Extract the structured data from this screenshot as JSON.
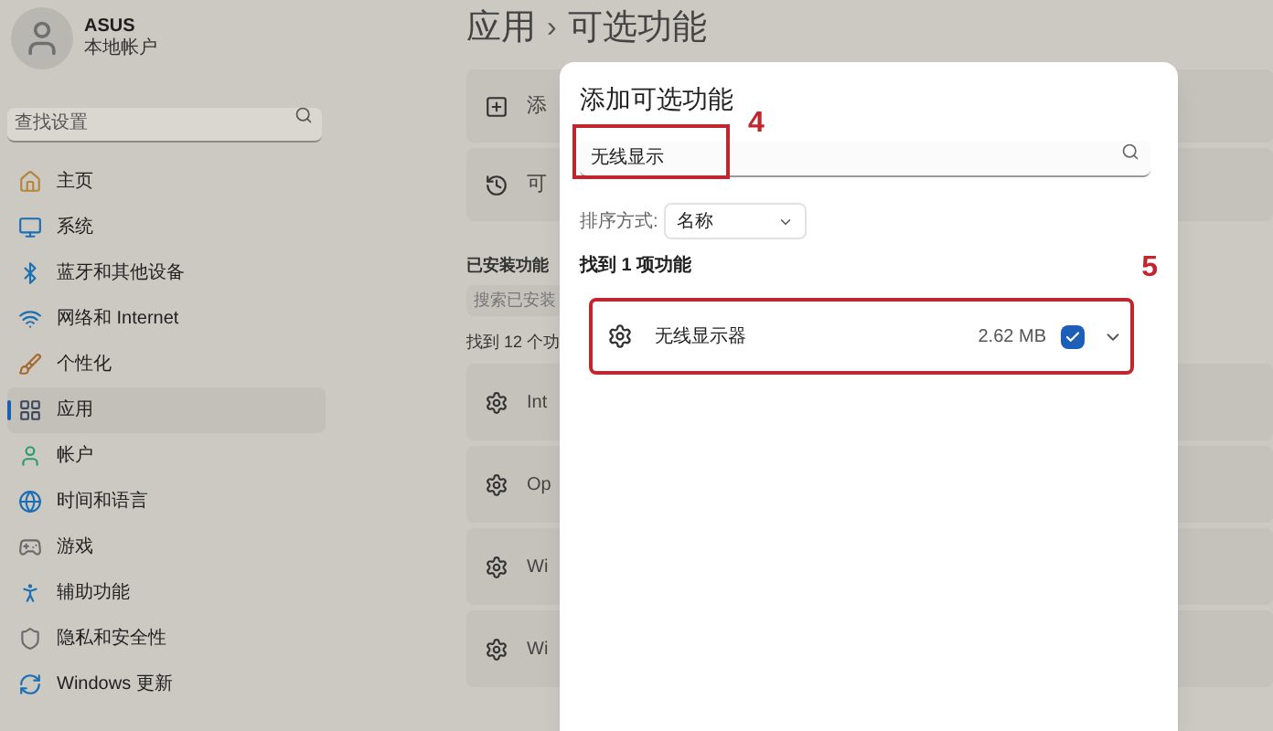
{
  "sidebar": {
    "user": {
      "name": "ASUS",
      "account_type": "本地帐户"
    },
    "search": {
      "placeholder": "查找设置"
    },
    "items": [
      {
        "label": "主页",
        "selected": false
      },
      {
        "label": "系统",
        "selected": false
      },
      {
        "label": "蓝牙和其他设备",
        "selected": false
      },
      {
        "label": "网络和 Internet",
        "selected": false
      },
      {
        "label": "个性化",
        "selected": false
      },
      {
        "label": "应用",
        "selected": true
      },
      {
        "label": "帐户",
        "selected": false
      },
      {
        "label": "时间和语言",
        "selected": false
      },
      {
        "label": "游戏",
        "selected": false
      },
      {
        "label": "辅助功能",
        "selected": false
      },
      {
        "label": "隐私和安全性",
        "selected": false
      },
      {
        "label": "Windows 更新",
        "selected": false
      }
    ]
  },
  "page": {
    "breadcrumb": {
      "parent": "应用",
      "separator": "›",
      "current": "可选功能"
    },
    "cards": [
      {
        "label": "添"
      },
      {
        "label": "可"
      }
    ],
    "installed": {
      "heading": "已安装功能",
      "search_placeholder": "搜索已安装",
      "count": "找到 12 个功",
      "items": [
        {
          "label": "Int"
        },
        {
          "label": "Op"
        },
        {
          "label": "Wi"
        },
        {
          "label": "Wi"
        }
      ]
    }
  },
  "dialog": {
    "title": "添加可选功能",
    "search": {
      "value": "无线显示"
    },
    "sort": {
      "label": "排序方式:",
      "value": "名称"
    },
    "result_count": "找到 1 项功能",
    "results": [
      {
        "name": "无线显示器",
        "size": "2.62 MB",
        "checked": true
      }
    ]
  },
  "annotations": [
    {
      "kind": "search",
      "label": "4"
    },
    {
      "kind": "result",
      "label": "5"
    }
  ]
}
